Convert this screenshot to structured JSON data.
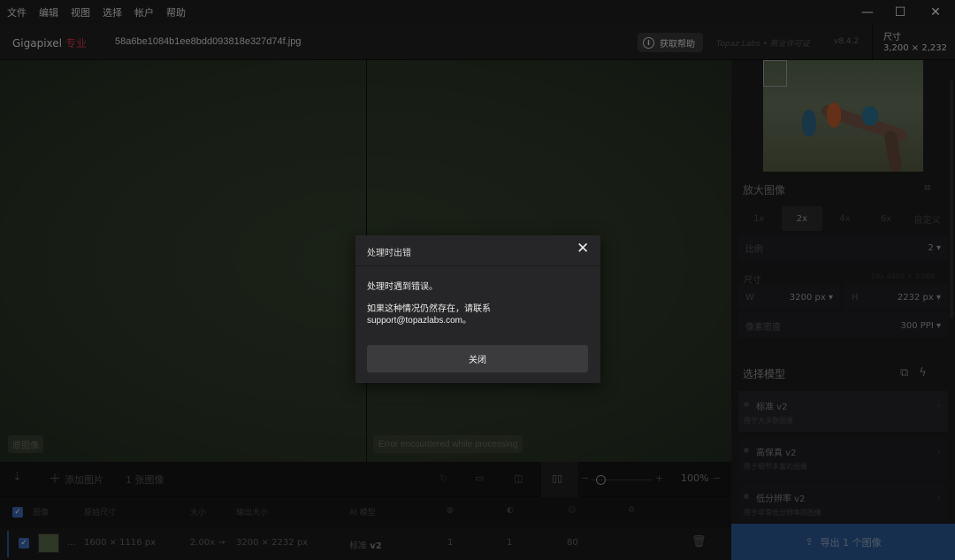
{
  "menu": {
    "items": [
      "文件",
      "编辑",
      "视图",
      "选择",
      "帐户",
      "帮助"
    ]
  },
  "window": {
    "minimize": "—",
    "maximize": "☐",
    "close": "✕"
  },
  "header": {
    "brand": "Gigapixel",
    "tier": "专业",
    "filename": "58a6be1084b1ee8bdd093818e327d74f.jpg",
    "help_label": "获取帮助",
    "license_text": "Topaz Labs • 商业许可证",
    "version": "v8.4.2",
    "dim_label": "尺寸",
    "dim_value": "3,200 × 2,232"
  },
  "canvas": {
    "original_tag": "原图像",
    "error_tag": "Error encountered while processing"
  },
  "dialog": {
    "title": "处理时出错",
    "close_glyph": "✕",
    "message_line1": "处理时遇到错误。",
    "message_line2": "如果这种情况仍然存在，请联系",
    "message_line3": "support@topazlabs.com。",
    "close_button": "关闭"
  },
  "right_panel": {
    "upscale_title": "放大图像",
    "scales": [
      "1x",
      "2x",
      "4x",
      "6x",
      "自定义"
    ],
    "active_scale_index": 1,
    "scale_label": "比例",
    "scale_value": "2 ▾",
    "size_label": "尺寸",
    "size_value": "16x 4400 × 3,068",
    "width_label": "W",
    "width_value": "3200 px ▾",
    "height_label": "H",
    "height_value": "2232 px ▾",
    "ppi_label": "像素密度",
    "ppi_value": "300 PPI ▾",
    "model_title": "选择模型",
    "models": [
      {
        "name": "标准 v2",
        "desc": "用于大多数图像"
      },
      {
        "name": "高保真 v2",
        "desc": "用于细节丰富的图像"
      },
      {
        "name": "低分辨率 v2",
        "desc": "用于非常低分辨率的图像"
      }
    ]
  },
  "toolbar": {
    "add_label": "添加图片",
    "count_label": "1 张图像",
    "zoom_value": "100%"
  },
  "table": {
    "headers": [
      "图像",
      "原始尺寸",
      "大小",
      "输出大小",
      "AI 模型"
    ],
    "row": {
      "ellipsis": "...",
      "orig_size": "1600 × 1116 px",
      "scale": "2.00x →",
      "out_size": "3200 × 2232 px",
      "model_prefix": "标准",
      "model_version": "v2",
      "v1": "1",
      "v2": "1",
      "v3": "80"
    }
  },
  "export": {
    "label": "导出 1 个图像"
  }
}
